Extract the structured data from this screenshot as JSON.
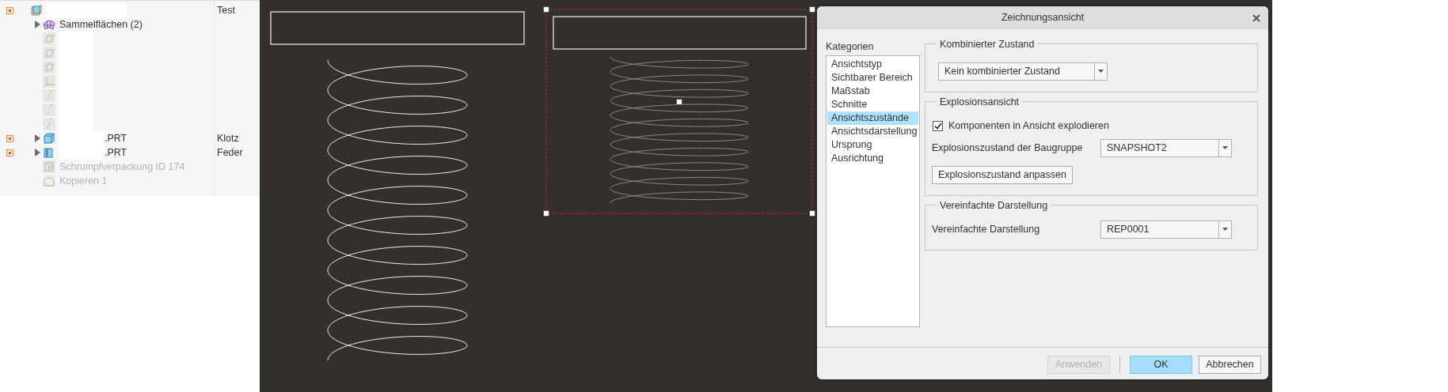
{
  "model_tree": {
    "rows": [
      {
        "kind": "assembly",
        "status_mark": true,
        "redacted": true,
        "note": "Test",
        "children": [
          {
            "kind": "quilt",
            "expanded": false,
            "label": "Sammelflächen (2)"
          },
          {
            "kind": "plane",
            "redacted": true
          },
          {
            "kind": "plane",
            "redacted": true
          },
          {
            "kind": "plane",
            "redacted": true
          },
          {
            "kind": "csys",
            "redacted": true
          },
          {
            "kind": "axis",
            "redacted": true
          },
          {
            "kind": "axis",
            "redacted": true
          },
          {
            "kind": "axis",
            "redacted": true
          },
          {
            "kind": "part",
            "status_mark": true,
            "expanded": false,
            "redacted": true,
            "label": ".PRT",
            "note": "Klotz"
          },
          {
            "kind": "spring",
            "status_mark": true,
            "expanded": false,
            "redacted": true,
            "label": ".PRT",
            "note": "Feder"
          },
          {
            "kind": "shrinkwrap",
            "disabled": true,
            "label": "Schrumpfverpackung ID 174"
          },
          {
            "kind": "copy",
            "disabled": true,
            "label": "Kopieren 1"
          }
        ]
      }
    ]
  },
  "drawing": {
    "views": [
      {
        "selected": false
      },
      {
        "selected": true
      }
    ]
  },
  "dialog": {
    "title": "Zeichnungsansicht",
    "categories_label": "Kategorien",
    "categories": [
      {
        "label": "Ansichtstyp",
        "selected": false
      },
      {
        "label": "Sichtbarer Bereich",
        "selected": false
      },
      {
        "label": "Maßstab",
        "selected": false
      },
      {
        "label": "Schnitte",
        "selected": false
      },
      {
        "label": "Ansichtszustände",
        "selected": true
      },
      {
        "label": "Ansichtsdarstellung",
        "selected": false
      },
      {
        "label": "Ursprung",
        "selected": false
      },
      {
        "label": "Ausrichtung",
        "selected": false
      }
    ],
    "groups": [
      {
        "title": "Kombinierter Zustand",
        "controls": [
          {
            "kind": "select",
            "value": "Kein kombinierter Zustand"
          }
        ]
      },
      {
        "title": "Explosionsansicht",
        "controls": [
          {
            "kind": "checkbox",
            "label": "Komponenten in Ansicht explodieren",
            "checked": true
          },
          {
            "kind": "select",
            "label": "Explosionszustand der Baugruppe",
            "value": "SNAPSHOT2"
          },
          {
            "kind": "button",
            "label": "Explosionszustand anpassen"
          }
        ]
      },
      {
        "title": "Vereinfachte Darstellung",
        "controls": [
          {
            "kind": "select",
            "label": "Vereinfachte Darstellung",
            "value": "REP0001"
          }
        ]
      }
    ],
    "buttons": [
      {
        "label": "Anwenden",
        "disabled": true,
        "primary": false
      },
      {
        "label": "OK",
        "disabled": false,
        "primary": true
      },
      {
        "label": "Abbrechen",
        "disabled": false,
        "primary": false
      }
    ]
  }
}
